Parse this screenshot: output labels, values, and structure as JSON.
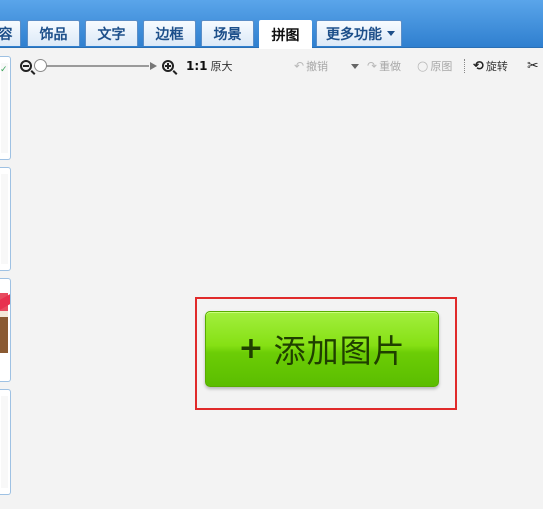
{
  "tabs": [
    {
      "label": "容",
      "active": false
    },
    {
      "label": "饰品",
      "active": false
    },
    {
      "label": "文字",
      "active": false
    },
    {
      "label": "边框",
      "active": false
    },
    {
      "label": "场景",
      "active": false
    },
    {
      "label": "拼图",
      "active": true
    },
    {
      "label": "更多功能",
      "active": false
    }
  ],
  "toolbar": {
    "zoom_ratio": "1:1",
    "original_size": "原大",
    "undo": "撤销",
    "redo": "重做",
    "original_image": "原图",
    "rotate": "旋转"
  },
  "canvas": {
    "add_photo_label": "添加图片",
    "plus_symbol": "+"
  },
  "colors": {
    "header": "#3b8ddf",
    "button_green": "#7ed60e",
    "highlight_red": "#e02a2a"
  }
}
